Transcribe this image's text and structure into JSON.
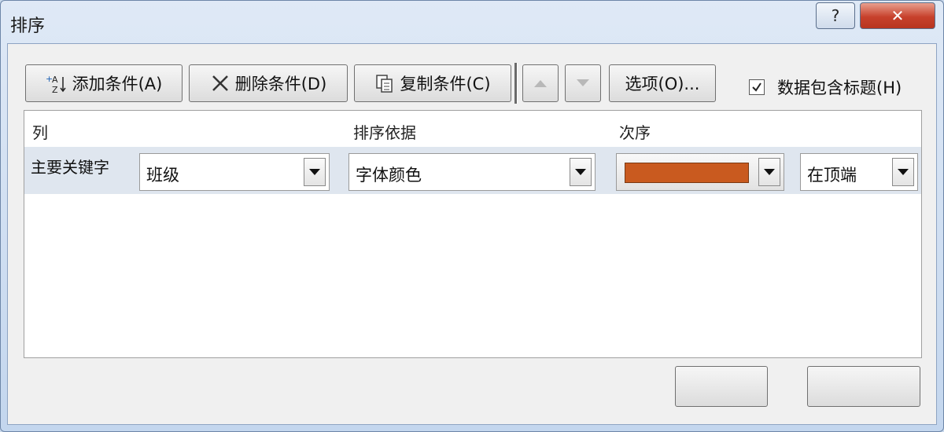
{
  "window": {
    "title": "排序"
  },
  "titlebar": {
    "help_label": "?",
    "close_label": "✕"
  },
  "toolbar": {
    "add_label": "添加条件(A)",
    "delete_label": "删除条件(D)",
    "copy_label": "复制条件(C)",
    "options_label": "选项(O)...",
    "header_checkbox_label": "数据包含标题(H)",
    "header_checkbox_checked": true
  },
  "grid": {
    "headers": {
      "column": "列",
      "sort_on": "排序依据",
      "order": "次序"
    },
    "rows": [
      {
        "label": "主要关键字",
        "column_value": "班级",
        "sort_on_value": "字体颜色",
        "order_color": "#c95a1f",
        "order_position": "在顶端"
      }
    ]
  },
  "colors": {
    "accent_swatch": "#c95a1f",
    "close_red": "#c7412c"
  }
}
